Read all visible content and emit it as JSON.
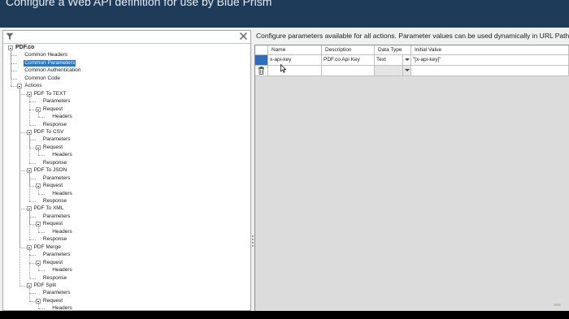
{
  "window": {
    "title": "Configure a Web API definition for use by Blue Prism"
  },
  "left": {
    "filter_placeholder": "",
    "tree": [
      {
        "label": "PDF.co",
        "level": 0,
        "root": true,
        "expander": true
      },
      {
        "label": "Common Headers",
        "level": 1
      },
      {
        "label": "Common Parameters",
        "level": 1,
        "selected": true
      },
      {
        "label": "Common Authentication",
        "level": 1
      },
      {
        "label": "Common Code",
        "level": 1
      },
      {
        "label": "Actions",
        "level": 1,
        "expander": true
      },
      {
        "label": "PDF To TEXT",
        "level": 2,
        "expander": true
      },
      {
        "label": "Parameters",
        "level": 3
      },
      {
        "label": "Request",
        "level": 3,
        "expander": true
      },
      {
        "label": "Headers",
        "level": 4
      },
      {
        "label": "Response",
        "level": 3
      },
      {
        "label": "PDF To CSV",
        "level": 2,
        "expander": true
      },
      {
        "label": "Parameters",
        "level": 3
      },
      {
        "label": "Request",
        "level": 3,
        "expander": true
      },
      {
        "label": "Headers",
        "level": 4
      },
      {
        "label": "Response",
        "level": 3
      },
      {
        "label": "PDF To JSON",
        "level": 2,
        "expander": true
      },
      {
        "label": "Parameters",
        "level": 3
      },
      {
        "label": "Request",
        "level": 3,
        "expander": true
      },
      {
        "label": "Headers",
        "level": 4
      },
      {
        "label": "Response",
        "level": 3
      },
      {
        "label": "PDF To XML",
        "level": 2,
        "expander": true
      },
      {
        "label": "Parameters",
        "level": 3
      },
      {
        "label": "Request",
        "level": 3,
        "expander": true
      },
      {
        "label": "Headers",
        "level": 4
      },
      {
        "label": "Response",
        "level": 3
      },
      {
        "label": "PDF Merge",
        "level": 2,
        "expander": true
      },
      {
        "label": "Parameters",
        "level": 3
      },
      {
        "label": "Request",
        "level": 3,
        "expander": true
      },
      {
        "label": "Headers",
        "level": 4
      },
      {
        "label": "Response",
        "level": 3
      },
      {
        "label": "PDF Split",
        "level": 2,
        "expander": true
      },
      {
        "label": "Parameters",
        "level": 3
      },
      {
        "label": "Request",
        "level": 3,
        "expander": true
      },
      {
        "label": "Headers",
        "level": 4
      }
    ]
  },
  "right": {
    "description": "Configure parameters available for all actions. Parameter values can be used dynamically in URL Paths",
    "columns": [
      "Name",
      "Description",
      "Data Type",
      "Initial Value"
    ],
    "rows": [
      {
        "name": "x-api-key",
        "description": "PDF.co Api Key",
        "data_type": "Text",
        "initial_value": "\"[x-api-key]\""
      }
    ]
  },
  "colors": {
    "title_bar": "#1f3b5a",
    "selection": "#1e78d7"
  }
}
